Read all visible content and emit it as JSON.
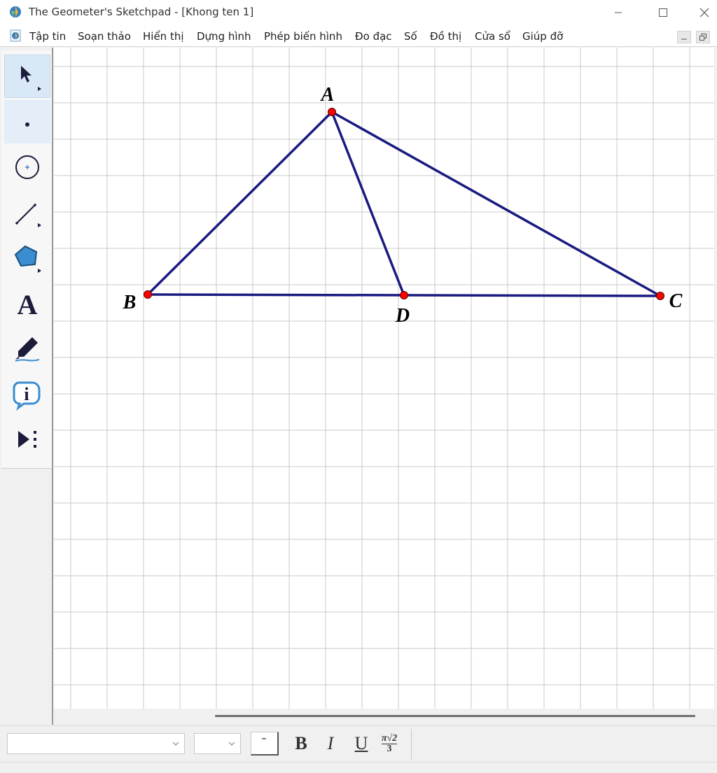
{
  "window": {
    "title": "The Geometer's Sketchpad - [Khong ten 1]"
  },
  "menu": {
    "items": [
      {
        "id": "file",
        "label": "Tập tin"
      },
      {
        "id": "edit",
        "label": "Soạn thảo"
      },
      {
        "id": "display",
        "label": "Hiển thị"
      },
      {
        "id": "construct",
        "label": "Dựng hình"
      },
      {
        "id": "transform",
        "label": "Phép biến hình"
      },
      {
        "id": "measure",
        "label": "Đo đạc"
      },
      {
        "id": "number",
        "label": "Số"
      },
      {
        "id": "graph",
        "label": "Đồ thị"
      },
      {
        "id": "window",
        "label": "Cửa sổ"
      },
      {
        "id": "help",
        "label": "Giúp đỡ"
      }
    ]
  },
  "toolbox": {
    "tools": [
      {
        "name": "selection-arrow-tool",
        "icon": "arrow-icon",
        "active": true
      },
      {
        "name": "point-tool",
        "icon": "point-icon"
      },
      {
        "name": "compass-tool",
        "icon": "circle-icon"
      },
      {
        "name": "straightedge-tool",
        "icon": "segment-icon"
      },
      {
        "name": "polygon-tool",
        "icon": "pentagon-icon"
      },
      {
        "name": "text-tool",
        "icon": "text-a-icon",
        "glyph": "A"
      },
      {
        "name": "marker-tool",
        "icon": "marker-pen-icon"
      },
      {
        "name": "information-tool",
        "icon": "info-icon",
        "glyph": "i"
      },
      {
        "name": "custom-tool",
        "icon": "play-custom-icon"
      }
    ]
  },
  "sketch": {
    "points": [
      {
        "id": "A",
        "label": "A"
      },
      {
        "id": "B",
        "label": "B"
      },
      {
        "id": "C",
        "label": "C"
      },
      {
        "id": "D",
        "label": "D"
      }
    ],
    "segments": [
      {
        "from": "A",
        "to": "B"
      },
      {
        "from": "A",
        "to": "C"
      },
      {
        "from": "A",
        "to": "D"
      },
      {
        "from": "B",
        "to": "C"
      }
    ],
    "colors": {
      "segment": "#1a1a80",
      "point": "#ff0000",
      "grid": "#c8c8c8"
    }
  },
  "formatbar": {
    "font_family_value": "",
    "font_size_value": "",
    "bold_label": "B",
    "italic_label": "I",
    "underline_label": "U",
    "math_top": "π√2",
    "math_bottom": "3"
  }
}
